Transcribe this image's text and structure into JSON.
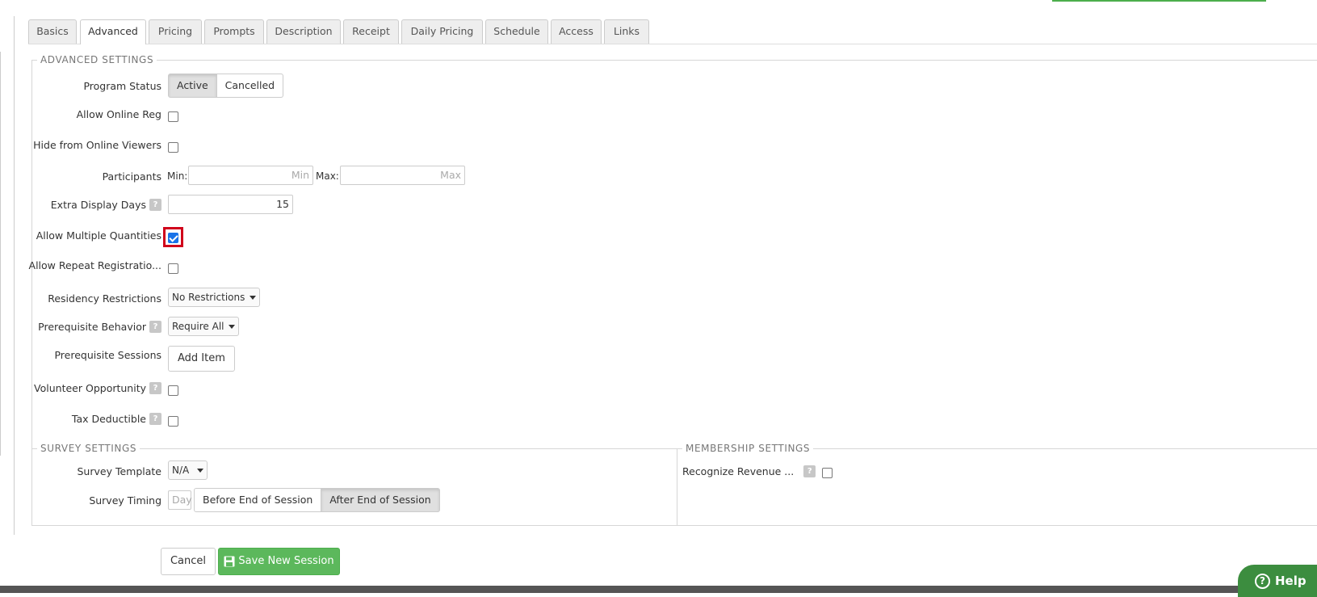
{
  "tabs": [
    "Basics",
    "Advanced",
    "Pricing",
    "Prompts",
    "Description",
    "Receipt",
    "Daily Pricing",
    "Schedule",
    "Access",
    "Links"
  ],
  "active_tab": "Advanced",
  "advanced": {
    "legend": "ADVANCED SETTINGS",
    "program_status": {
      "label": "Program Status",
      "options": [
        "Active",
        "Cancelled"
      ],
      "selected": "Active"
    },
    "allow_online_reg": {
      "label": "Allow Online Reg",
      "checked": false
    },
    "hide_online": {
      "label": "Hide from Online Viewers",
      "checked": false
    },
    "participants": {
      "label": "Participants",
      "min_label": "Min:",
      "min_placeholder": "Min",
      "max_label": "Max:",
      "max_placeholder": "Max"
    },
    "extra_display_days": {
      "label": "Extra Display Days",
      "value": "15",
      "help": "?"
    },
    "allow_multiple_quantities": {
      "label": "Allow Multiple Quantities",
      "checked": true
    },
    "allow_repeat": {
      "label": "Allow Repeat Registratio...",
      "checked": false
    },
    "residency": {
      "label": "Residency Restrictions",
      "value": "No Restrictions"
    },
    "prereq_behavior": {
      "label": "Prerequisite Behavior",
      "value": "Require All",
      "help": "?"
    },
    "prereq_sessions": {
      "label": "Prerequisite Sessions",
      "button": "Add Item"
    },
    "volunteer": {
      "label": "Volunteer Opportunity",
      "help": "?",
      "checked": false
    },
    "tax": {
      "label": "Tax Deductible",
      "help": "?",
      "checked": false
    }
  },
  "survey": {
    "legend": "SURVEY SETTINGS",
    "template": {
      "label": "Survey Template",
      "value": "N/A"
    },
    "timing": {
      "label": "Survey Timing",
      "day_placeholder": "Day",
      "options": [
        "Before End of Session",
        "After End of Session"
      ],
      "selected": "After End of Session"
    }
  },
  "membership": {
    "legend": "MEMBERSHIP SETTINGS",
    "recognize": {
      "label": "Recognize Revenue ...",
      "help": "?",
      "checked": false
    }
  },
  "actions": {
    "cancel": "Cancel",
    "save": "Save New Session"
  },
  "help": {
    "label": "Help",
    "icon": "?"
  },
  "colors": {
    "accent_green": "#5cb85c",
    "highlight_red": "#d0021b",
    "checkbox_blue": "#1a73e8"
  }
}
